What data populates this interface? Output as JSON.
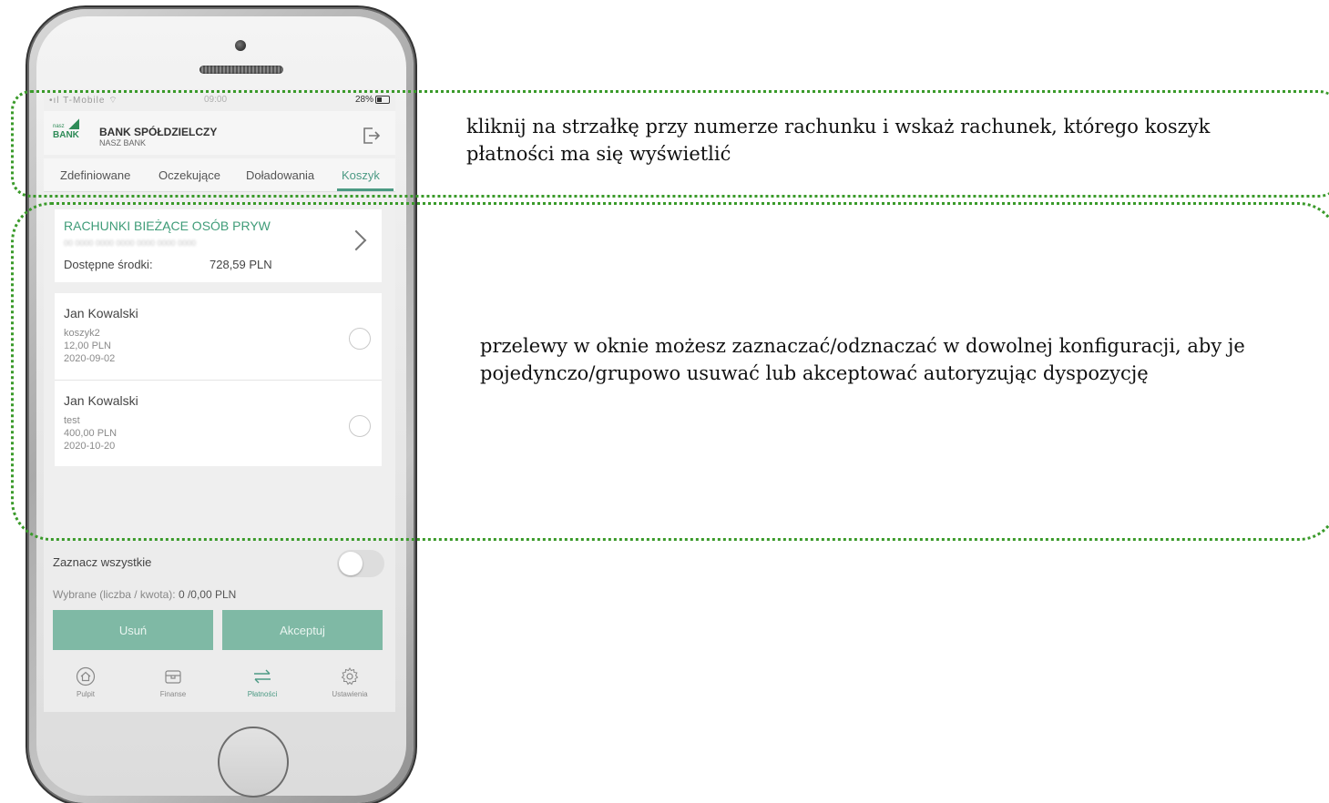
{
  "status_bar": {
    "signal": "•ıl T-Mobile ⌔",
    "time": "09:00",
    "battery": "28%"
  },
  "header": {
    "logo_top": "nasz",
    "logo_main": "BANK",
    "bank_name": "BANK SPÓŁDZIELCZY",
    "bank_subname": "NASZ BANK"
  },
  "tabs": [
    {
      "label": "Zdefiniowane",
      "active": false
    },
    {
      "label": "Oczekujące",
      "active": false
    },
    {
      "label": "Doładowania",
      "active": false
    },
    {
      "label": "Koszyk",
      "active": true
    }
  ],
  "account": {
    "name": "RACHUNKI BIEŻĄCE OSÓB PRYW",
    "number": "00 0000 0000 0000 0000 0000 0000",
    "available_label": "Dostępne środki:",
    "available_value": "728,59 PLN"
  },
  "payments": [
    {
      "recipient": "Jan Kowalski",
      "title": "koszyk2",
      "amount": "12,00 PLN",
      "date": "2020-09-02"
    },
    {
      "recipient": "Jan Kowalski",
      "title": "test",
      "amount": "400,00 PLN",
      "date": "2020-10-20"
    }
  ],
  "bottom": {
    "select_all": "Zaznacz wszystkie",
    "selected_label": "Wybrane (liczba / kwota):",
    "selected_value": "0 /0,00 PLN",
    "delete_button": "Usuń",
    "accept_button": "Akceptuj"
  },
  "nav": [
    {
      "label": "Pulpit",
      "icon": "home-icon",
      "active": false
    },
    {
      "label": "Finanse",
      "icon": "wallet-icon",
      "active": false
    },
    {
      "label": "Płatności",
      "icon": "transfer-icon",
      "active": true
    },
    {
      "label": "Ustawienia",
      "icon": "gear-icon",
      "active": false
    }
  ],
  "annotations": {
    "note1": "kliknij na strzałkę przy numerze rachunku i wskaż rachunek, którego koszyk płatności ma się wyświetlić",
    "note2": "przelewy w oknie możesz zaznaczać/odznaczać w dowolnej konfiguracji, aby je pojedynczo/grupowo usuwać lub akceptować autoryzując dyspozycję"
  },
  "colors": {
    "accent": "#4c9a84",
    "button": "#7fb9a5",
    "callout": "#3a9a2a"
  }
}
